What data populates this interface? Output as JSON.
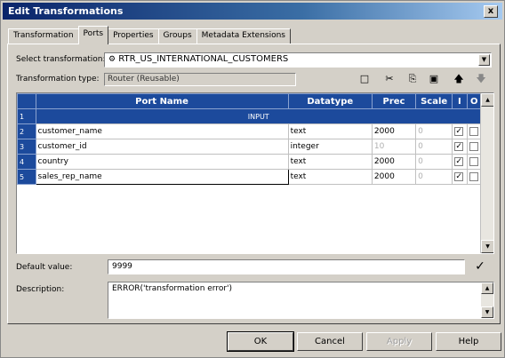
{
  "window": {
    "title": "Edit Transformations",
    "close_label": "x"
  },
  "tabs": [
    {
      "label": "Transformation",
      "active": false
    },
    {
      "label": "Ports",
      "active": true
    },
    {
      "label": "Properties",
      "active": false
    },
    {
      "label": "Groups",
      "active": false
    },
    {
      "label": "Metadata Extensions",
      "active": false
    }
  ],
  "form": {
    "select_transformation_label": "Select transformation:",
    "select_transformation_value": "RTR_US_INTERNATIONAL_CUSTOMERS",
    "transformation_type_label": "Transformation type:",
    "transformation_type_value": "Router (Reusable)"
  },
  "toolbar": {
    "icons": [
      "new-port-icon",
      "cut-icon",
      "copy-icon",
      "paste-icon",
      "move-up-icon",
      "move-down-icon"
    ],
    "glyphs": [
      "□",
      "✂",
      "⎘",
      "▣",
      "🡅",
      "🡇"
    ]
  },
  "grid": {
    "columns": [
      "Port Name",
      "Datatype",
      "Prec",
      "Scale",
      "I",
      "O"
    ],
    "group_label": "INPUT",
    "row_numbers": [
      "1",
      "2",
      "3",
      "4",
      "5"
    ],
    "rows": [
      {
        "name": "customer_name",
        "datatype": "text",
        "prec": "2000",
        "scale": "0",
        "i": true,
        "o": false
      },
      {
        "name": "customer_id",
        "datatype": "integer",
        "prec": "10",
        "scale": "0",
        "i": true,
        "o": false
      },
      {
        "name": "country",
        "datatype": "text",
        "prec": "2000",
        "scale": "0",
        "i": true,
        "o": false
      },
      {
        "name": "sales_rep_name",
        "datatype": "text",
        "prec": "2000",
        "scale": "0",
        "i": true,
        "o": false
      }
    ]
  },
  "default_value": {
    "label": "Default value:",
    "value": "9999"
  },
  "description": {
    "label": "Description:",
    "value": "ERROR('transformation error')"
  },
  "buttons": {
    "ok": "OK",
    "cancel": "Cancel",
    "apply": "Apply",
    "help": "Help"
  }
}
